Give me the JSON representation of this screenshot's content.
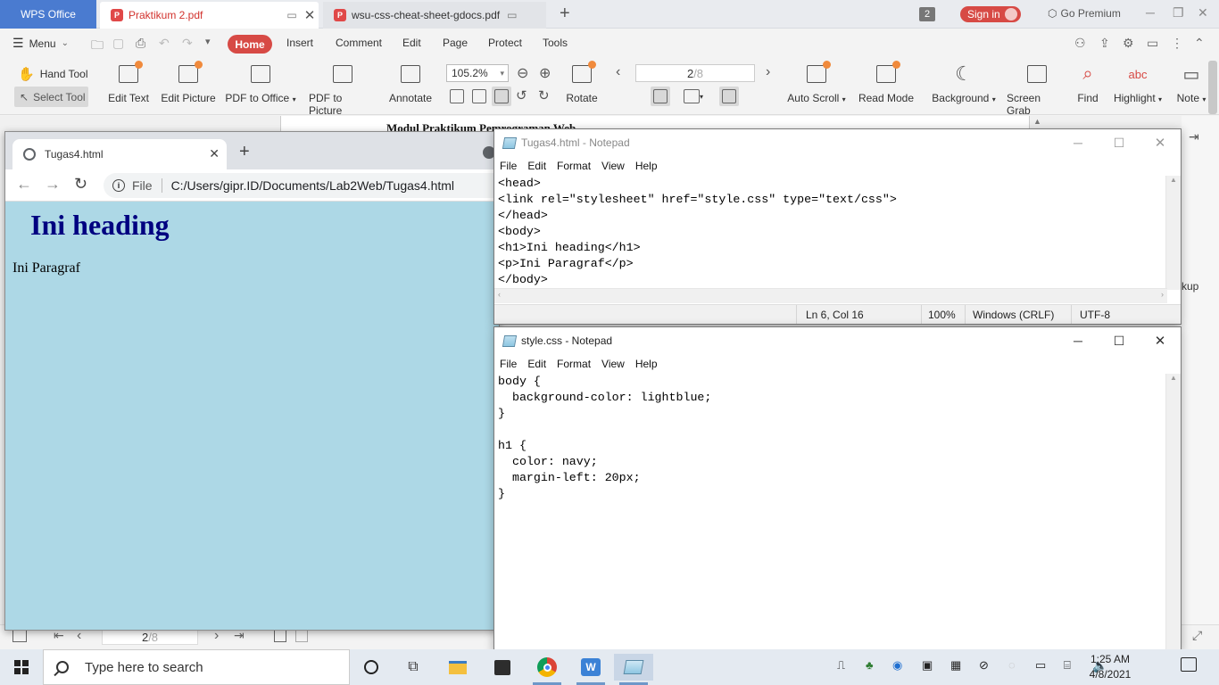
{
  "wps": {
    "home_tab": "WPS Office",
    "tabs": [
      {
        "label": "Praktikum 2.pdf"
      },
      {
        "label": "wsu-css-cheat-sheet-gdocs.pdf"
      }
    ],
    "tab_count": "2",
    "sign_in": "Sign in",
    "go_premium": "Go Premium",
    "menu_label": "Menu",
    "ribbon_tabs": [
      "Home",
      "Insert",
      "Comment",
      "Edit",
      "Page",
      "Protect",
      "Tools"
    ],
    "toolbar": {
      "hand_tool": "Hand Tool",
      "select_tool": "Select Tool",
      "edit_text": "Edit Text",
      "edit_picture": "Edit Picture",
      "pdf_to_office": "PDF to Office",
      "pdf_to_picture": "PDF to Picture",
      "annotate": "Annotate",
      "zoom": "105.2%",
      "rotate": "Rotate",
      "page_current": "2",
      "page_total": "/8",
      "auto_scroll": "Auto Scroll",
      "read_mode": "Read Mode",
      "background": "Background",
      "screen_grab": "Screen Grab",
      "find": "Find",
      "highlight": "Highlight",
      "note": "Note"
    },
    "document_title": "Modul Praktikum Pemrograman Web",
    "side_text": "kup",
    "status_page_current": "2",
    "status_page_total": "/8"
  },
  "browser": {
    "tab_title": "Tugas4.html",
    "omnibox_scheme": "File",
    "omnibox_path": "C:/Users/gipr.ID/Documents/Lab2Web/Tugas4.html",
    "page_heading": "Ini heading",
    "page_paragraph": "Ini Paragraf",
    "page_bg": "#add8e6",
    "heading_color": "navy"
  },
  "notepad_html": {
    "title": "Tugas4.html - Notepad",
    "menu": [
      "File",
      "Edit",
      "Format",
      "View",
      "Help"
    ],
    "content": "<head>\n<link rel=\"stylesheet\" href=\"style.css\" type=\"text/css\">\n</head>\n<body>\n<h1>Ini heading</h1>\n<p>Ini Paragraf</p>\n</body>",
    "status": {
      "position": "Ln 6, Col 16",
      "zoom": "100%",
      "line_ending": "Windows (CRLF)",
      "encoding": "UTF-8"
    }
  },
  "notepad_css": {
    "title": "style.css - Notepad",
    "menu": [
      "File",
      "Edit",
      "Format",
      "View",
      "Help"
    ],
    "content": "body {\n  background-color: lightblue;\n}\n\nh1 {\n  color: navy;\n  margin-left: 20px;\n}"
  },
  "taskbar": {
    "search_placeholder": "Type here to search",
    "time": "1:25 AM",
    "date": "4/8/2021"
  }
}
